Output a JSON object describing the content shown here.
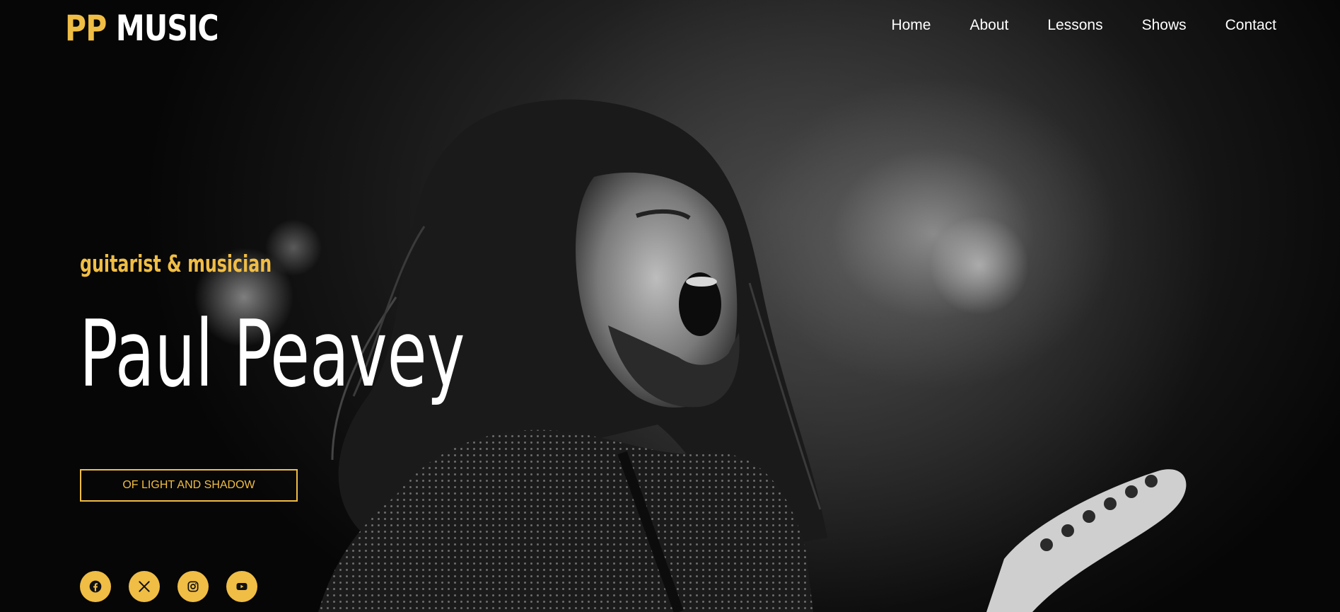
{
  "header": {
    "logo_pp": "PP",
    "logo_music": "MUSIC",
    "nav": [
      {
        "label": "Home"
      },
      {
        "label": "About"
      },
      {
        "label": "Lessons"
      },
      {
        "label": "Shows"
      },
      {
        "label": "Contact"
      }
    ]
  },
  "hero": {
    "subtitle": "guitarist & musician",
    "name": "Paul Peavey",
    "cta_label": "OF LIGHT AND SHADOW",
    "background_image": "black-and-white photo of a long-haired guitarist singing on stage"
  },
  "socials": [
    {
      "icon": "facebook-icon"
    },
    {
      "icon": "x-icon"
    },
    {
      "icon": "instagram-icon"
    },
    {
      "icon": "youtube-icon"
    }
  ],
  "colors": {
    "accent": "#f0bd45",
    "text": "#ffffff",
    "background": "#0a0a0a"
  }
}
